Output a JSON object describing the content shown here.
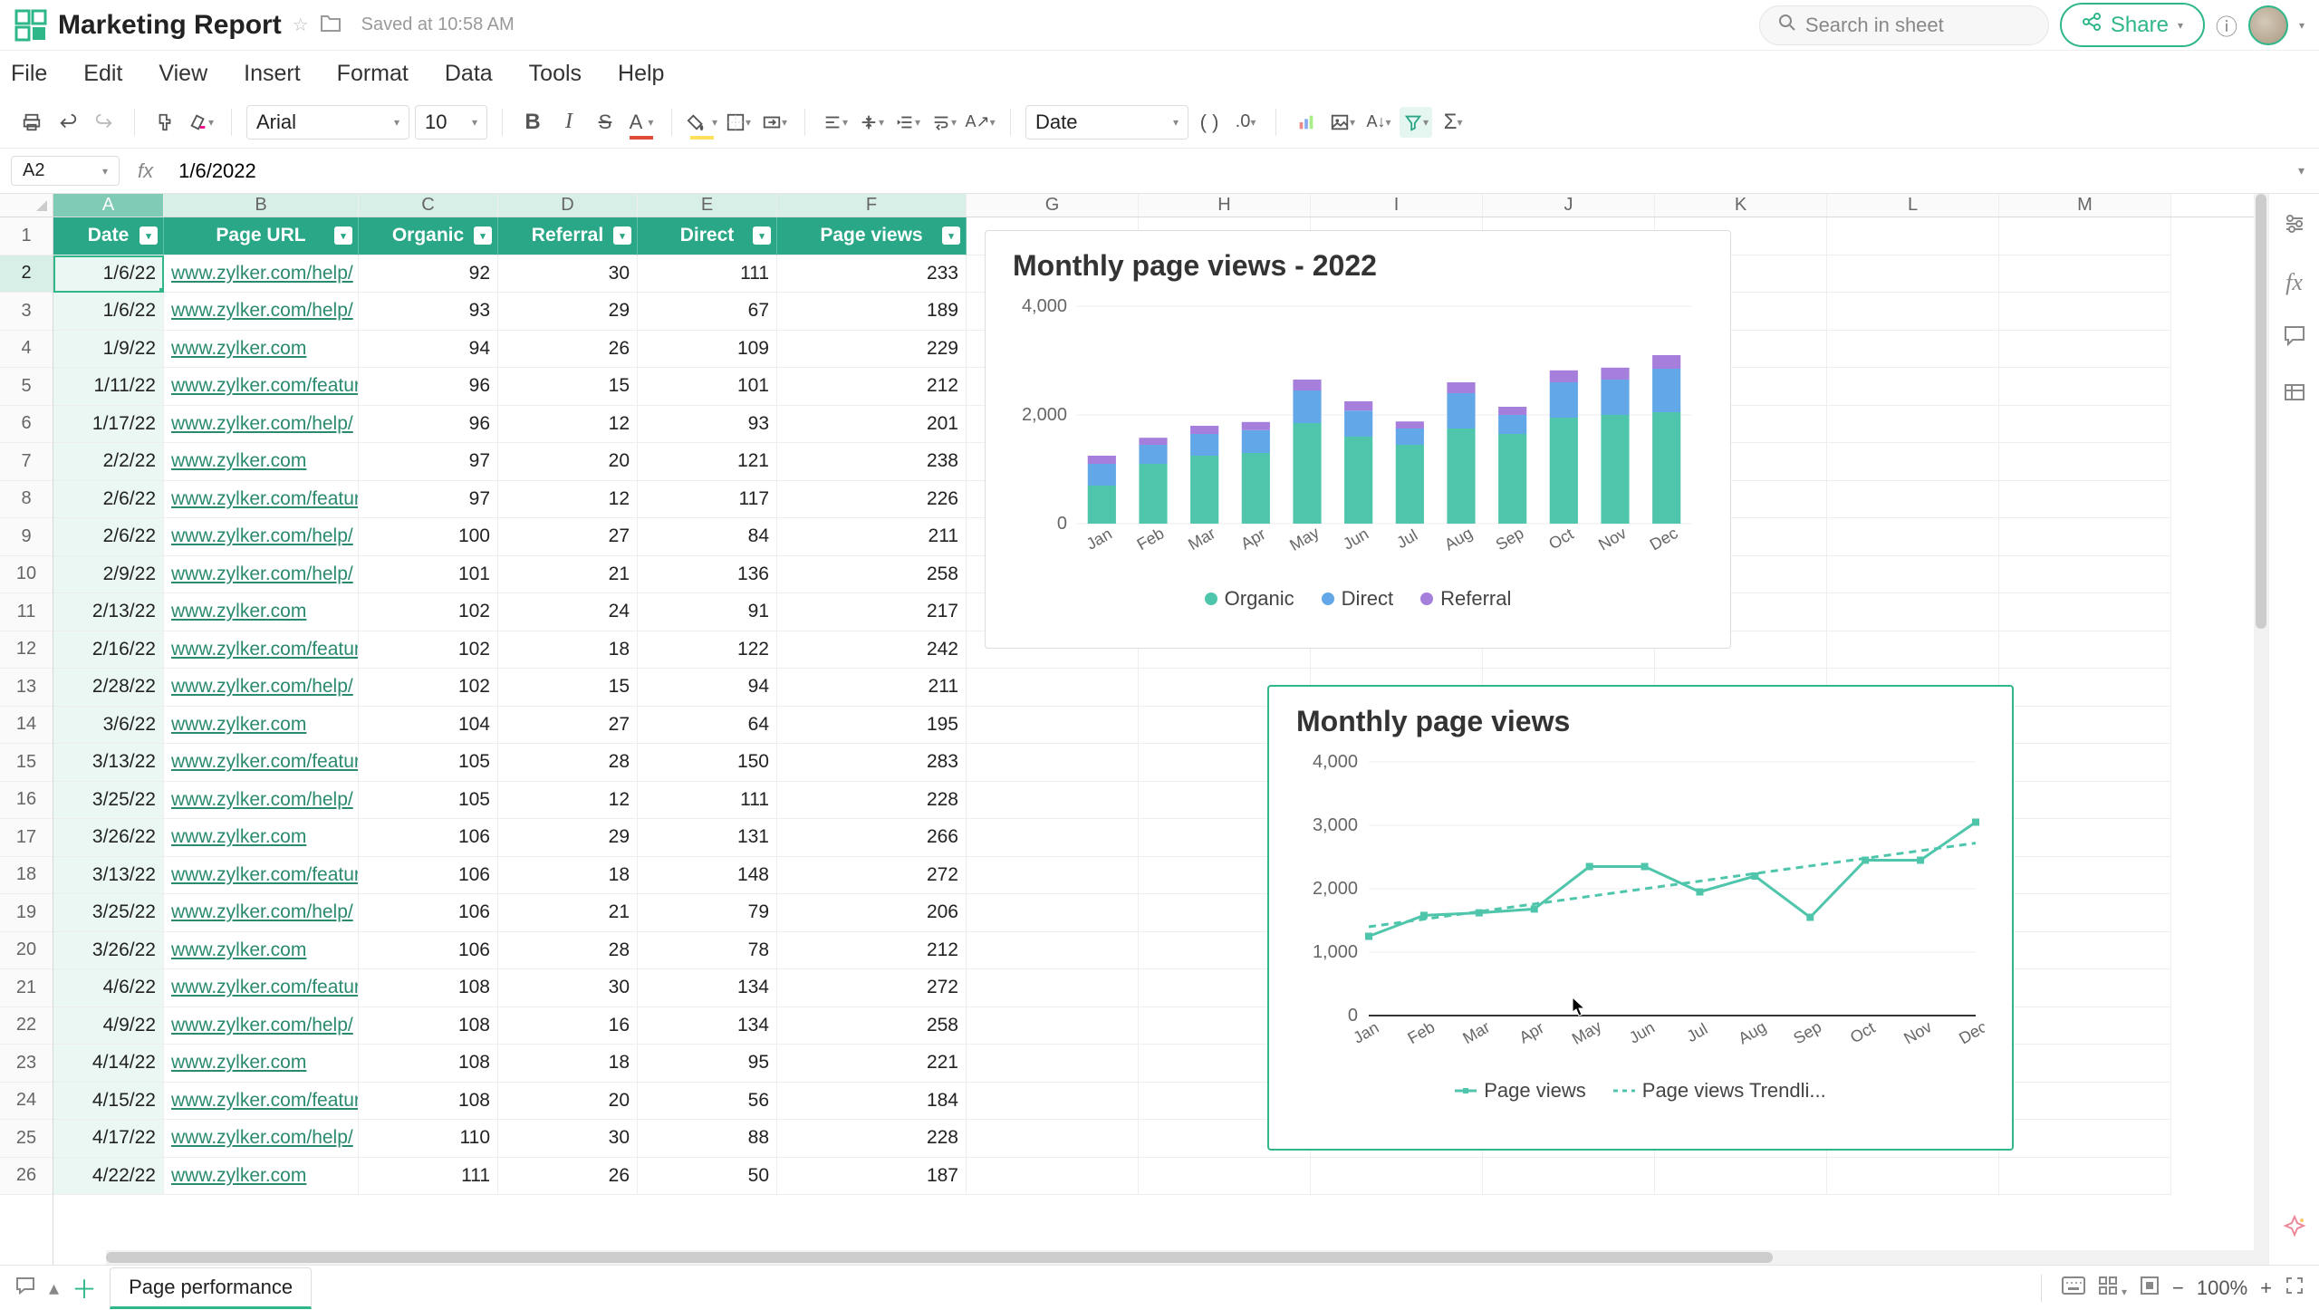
{
  "titlebar": {
    "doc_title": "Marketing Report",
    "saved_text": "Saved at 10:58 AM",
    "search_placeholder": "Search in sheet",
    "share_label": "Share"
  },
  "menubar": [
    "File",
    "Edit",
    "View",
    "Insert",
    "Format",
    "Data",
    "Tools",
    "Help"
  ],
  "toolbar": {
    "font_family": "Arial",
    "font_size": "10",
    "number_format": "Date"
  },
  "formula": {
    "name_box": "A2",
    "fx_label": "fx",
    "value": "1/6/2022"
  },
  "columns_visible": [
    "A",
    "B",
    "C",
    "D",
    "E",
    "F",
    "G",
    "H",
    "I",
    "J",
    "K",
    "L",
    "M"
  ],
  "table": {
    "headers": [
      "Date",
      "Page URL",
      "Organic",
      "Referral",
      "Direct",
      "Page views"
    ],
    "rows": [
      [
        "1/6/22",
        "www.zylker.com/help/",
        "92",
        "30",
        "111",
        "233"
      ],
      [
        "1/6/22",
        "www.zylker.com/help/",
        "93",
        "29",
        "67",
        "189"
      ],
      [
        "1/9/22",
        "www.zylker.com",
        "94",
        "26",
        "109",
        "229"
      ],
      [
        "1/11/22",
        "www.zylker.com/features/",
        "96",
        "15",
        "101",
        "212"
      ],
      [
        "1/17/22",
        "www.zylker.com/help/",
        "96",
        "12",
        "93",
        "201"
      ],
      [
        "2/2/22",
        "www.zylker.com",
        "97",
        "20",
        "121",
        "238"
      ],
      [
        "2/6/22",
        "www.zylker.com/features/",
        "97",
        "12",
        "117",
        "226"
      ],
      [
        "2/6/22",
        "www.zylker.com/help/",
        "100",
        "27",
        "84",
        "211"
      ],
      [
        "2/9/22",
        "www.zylker.com/help/",
        "101",
        "21",
        "136",
        "258"
      ],
      [
        "2/13/22",
        "www.zylker.com",
        "102",
        "24",
        "91",
        "217"
      ],
      [
        "2/16/22",
        "www.zylker.com/features/",
        "102",
        "18",
        "122",
        "242"
      ],
      [
        "2/28/22",
        "www.zylker.com/help/",
        "102",
        "15",
        "94",
        "211"
      ],
      [
        "3/6/22",
        "www.zylker.com",
        "104",
        "27",
        "64",
        "195"
      ],
      [
        "3/13/22",
        "www.zylker.com/features/",
        "105",
        "28",
        "150",
        "283"
      ],
      [
        "3/25/22",
        "www.zylker.com/help/",
        "105",
        "12",
        "111",
        "228"
      ],
      [
        "3/26/22",
        "www.zylker.com",
        "106",
        "29",
        "131",
        "266"
      ],
      [
        "3/13/22",
        "www.zylker.com/features/",
        "106",
        "18",
        "148",
        "272"
      ],
      [
        "3/25/22",
        "www.zylker.com/help/",
        "106",
        "21",
        "79",
        "206"
      ],
      [
        "3/26/22",
        "www.zylker.com",
        "106",
        "28",
        "78",
        "212"
      ],
      [
        "4/6/22",
        "www.zylker.com/features/",
        "108",
        "30",
        "134",
        "272"
      ],
      [
        "4/9/22",
        "www.zylker.com/help/",
        "108",
        "16",
        "134",
        "258"
      ],
      [
        "4/14/22",
        "www.zylker.com",
        "108",
        "18",
        "95",
        "221"
      ],
      [
        "4/15/22",
        "www.zylker.com/features/",
        "108",
        "20",
        "56",
        "184"
      ],
      [
        "4/17/22",
        "www.zylker.com/help/",
        "110",
        "30",
        "88",
        "228"
      ],
      [
        "4/22/22",
        "www.zylker.com",
        "111",
        "26",
        "50",
        "187"
      ]
    ]
  },
  "footer": {
    "sheet_tab": "Page performance",
    "zoom": "100%"
  },
  "chart_data": [
    {
      "type": "bar",
      "stacked": true,
      "title": "Monthly page views - 2022",
      "categories": [
        "Jan",
        "Feb",
        "Mar",
        "Apr",
        "May",
        "Jun",
        "Jul",
        "Aug",
        "Sep",
        "Oct",
        "Nov",
        "Dec"
      ],
      "series": [
        {
          "name": "Organic",
          "color": "#4fc6ab",
          "values": [
            700,
            1100,
            1250,
            1300,
            1850,
            1600,
            1450,
            1750,
            1650,
            1950,
            2000,
            2050
          ]
        },
        {
          "name": "Direct",
          "color": "#62a8e8",
          "values": [
            400,
            350,
            400,
            420,
            600,
            480,
            300,
            650,
            350,
            650,
            650,
            800
          ]
        },
        {
          "name": "Referral",
          "color": "#a67edb",
          "values": [
            150,
            130,
            150,
            150,
            200,
            170,
            130,
            200,
            150,
            220,
            220,
            250
          ]
        }
      ],
      "ylabel": "",
      "xlabel": "",
      "ylim": [
        0,
        4000
      ],
      "y_ticks": [
        0,
        2000,
        4000
      ],
      "legend_position": "bottom"
    },
    {
      "type": "line",
      "title": "Monthly page views",
      "categories": [
        "Jan",
        "Feb",
        "Mar",
        "Apr",
        "May",
        "Jun",
        "Jul",
        "Aug",
        "Sep",
        "Oct",
        "Nov",
        "Dec"
      ],
      "series": [
        {
          "name": "Page views",
          "color": "#4fc6ab",
          "values": [
            1250,
            1580,
            1620,
            1680,
            2350,
            2350,
            1950,
            2200,
            1550,
            2450,
            2450,
            3050
          ]
        },
        {
          "name": "Page views Trendli...",
          "color": "#4fc6ab",
          "dashed": true,
          "values": [
            1400,
            1520,
            1640,
            1760,
            1880,
            2000,
            2120,
            2240,
            2360,
            2480,
            2600,
            2720
          ]
        }
      ],
      "ylabel": "",
      "xlabel": "",
      "ylim": [
        0,
        4000
      ],
      "y_ticks": [
        0,
        1000,
        2000,
        3000,
        4000
      ],
      "legend_position": "bottom"
    }
  ]
}
